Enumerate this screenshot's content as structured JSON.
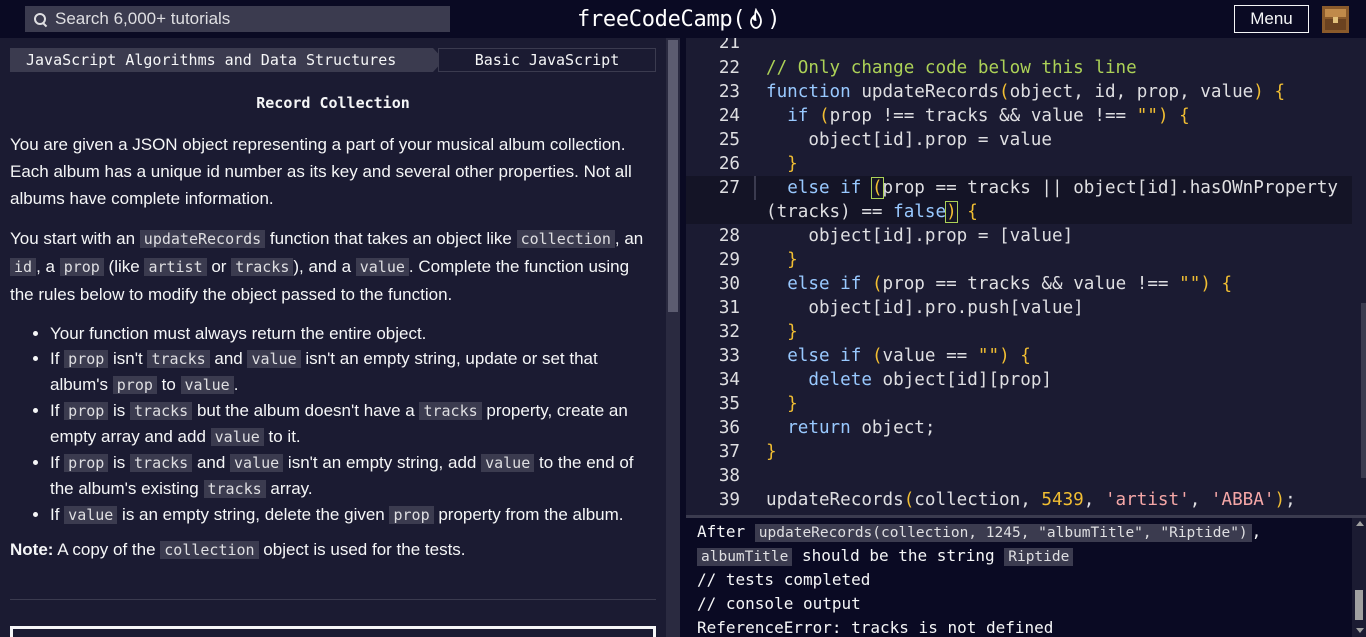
{
  "nav": {
    "search_placeholder": "Search 6,000+ tutorials",
    "brand_left": "freeCodeCamp(",
    "brand_right": ")",
    "menu_label": "Menu"
  },
  "breadcrumb": {
    "superblock": "JavaScript Algorithms and Data Structures",
    "block": "Basic JavaScript"
  },
  "challenge": {
    "title": "Record Collection",
    "p1": "You are given a JSON object representing a part of your musical album collection. Each album has a unique id number as its key and several other properties. Not all albums have complete information.",
    "p2": {
      "t1": "You start with an ",
      "c1": "updateRecords",
      "t2": " function that takes an object like ",
      "c2": "collection",
      "t3": ", an ",
      "c3": "id",
      "t4": ", a ",
      "c4": "prop",
      "t5": " (like ",
      "c5": "artist",
      "t6": " or ",
      "c6": "tracks",
      "t7": "), and a ",
      "c7": "value",
      "t8": ". Complete the function using the rules below to modify the object passed to the function."
    },
    "rules": {
      "r1": "Your function must always return the entire object.",
      "r2": {
        "t1": "If ",
        "c1": "prop",
        "t2": " isn't ",
        "c2": "tracks",
        "t3": " and ",
        "c3": "value",
        "t4": " isn't an empty string, update or set that album's ",
        "c4": "prop",
        "t5": " to ",
        "c5": "value",
        "t6": "."
      },
      "r3": {
        "t1": "If ",
        "c1": "prop",
        "t2": " is ",
        "c2": "tracks",
        "t3": " but the album doesn't have a ",
        "c3": "tracks",
        "t4": " property, create an empty array and add ",
        "c4": "value",
        "t5": " to it."
      },
      "r4": {
        "t1": "If ",
        "c1": "prop",
        "t2": " is ",
        "c2": "tracks",
        "t3": " and ",
        "c3": "value",
        "t4": " isn't an empty string, add ",
        "c4": "value",
        "t5": " to the end of the album's existing ",
        "c5": "tracks",
        "t6": " array."
      },
      "r5": {
        "t1": "If ",
        "c1": "value",
        "t2": " is an empty string, delete the given ",
        "c2": "prop",
        "t3": " property from the album."
      }
    },
    "note": {
      "label": "Note:",
      "t1": " A copy of the ",
      "c1": "collection",
      "t2": " object is used for the tests."
    }
  },
  "editor": {
    "line_numbers": [
      "21",
      "22",
      "23",
      "24",
      "25",
      "26",
      "27",
      "28",
      "29",
      "30",
      "31",
      "32",
      "33",
      "34",
      "35",
      "36",
      "37",
      "38",
      "39"
    ],
    "comment": "// Only change code below this line",
    "l23": {
      "kw": "function",
      "name": " updateRecords",
      "open": "(",
      "params": "object, id, prop, value",
      "close": ")",
      "brace": " {"
    },
    "l24": {
      "indent": "  ",
      "kw": "if",
      "sp": " ",
      "open": "(",
      "expr": "prop !== tracks && value !== ",
      "str": "\"\"",
      "close": ")",
      "brace": " {"
    },
    "l25": "    object[id].prop = value",
    "l26": "  }",
    "l27": {
      "indent": "  ",
      "kw1": "else",
      "sp": " ",
      "kw2": "if",
      "sp2": " ",
      "open": "(",
      "expr": "prop == tracks || object[id].hasOWnProperty"
    },
    "l27b": {
      "expr": "(tracks) == ",
      "kw": "false",
      "close": ")",
      "brace": " {"
    },
    "l28": "    object[id].prop = [value]",
    "l29": "  }",
    "l30": {
      "indent": "  ",
      "kw1": "else",
      "sp": " ",
      "kw2": "if",
      "sp2": " ",
      "open": "(",
      "expr": "prop == tracks && value !== ",
      "str": "\"\"",
      "close": ")",
      "brace": " {"
    },
    "l31": "    object[id].pro.push[value]",
    "l32": "  }",
    "l33": {
      "indent": "  ",
      "kw1": "else",
      "sp": " ",
      "kw2": "if",
      "sp2": " ",
      "open": "(",
      "expr": "value == ",
      "str": "\"\"",
      "close": ")",
      "brace": " {"
    },
    "l34": {
      "indent": "    ",
      "kw": "delete",
      "rest": " object[id][prop]"
    },
    "l35": "  }",
    "l36": {
      "indent": "  ",
      "kw": "return",
      "rest": " object;"
    },
    "l37": "}",
    "l38": "",
    "l39": {
      "name": "updateRecords",
      "open": "(",
      "a1": "collection, ",
      "num": "5439",
      "c1": ", ",
      "s1": "'artist'",
      "c2": ", ",
      "s2": "'ABBA'",
      "close": ")",
      "end": ";"
    }
  },
  "console": {
    "l1_pre": "After ",
    "l1_code": "updateRecords(collection, 1245, \"albumTitle\", \"Riptide\")",
    "l1_post": ",",
    "l2_code1": "albumTitle",
    "l2_mid": " should be the string ",
    "l2_code2": "Riptide",
    "l3": "// tests completed",
    "l4": "// console output",
    "l5": "ReferenceError: tracks is not defined"
  }
}
